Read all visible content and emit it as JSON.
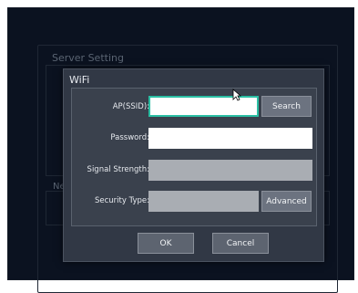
{
  "background": {
    "section_title": "Server Setting",
    "section2_label": "Ne"
  },
  "dialog": {
    "title": "WiFi",
    "fields": {
      "ssid_label": "AP(SSID):",
      "ssid_value": "",
      "password_label": "Password:",
      "password_value": "",
      "signal_label": "Signal Strength:",
      "signal_value": "",
      "security_label": "Security Type:",
      "security_value": ""
    },
    "buttons": {
      "search": "Search",
      "advanced": "Advanced",
      "ok": "OK",
      "cancel": "Cancel"
    }
  },
  "colors": {
    "focus_border": "#2bbfa4",
    "dialog_bg": "#313845",
    "app_bg": "#0b1220"
  }
}
